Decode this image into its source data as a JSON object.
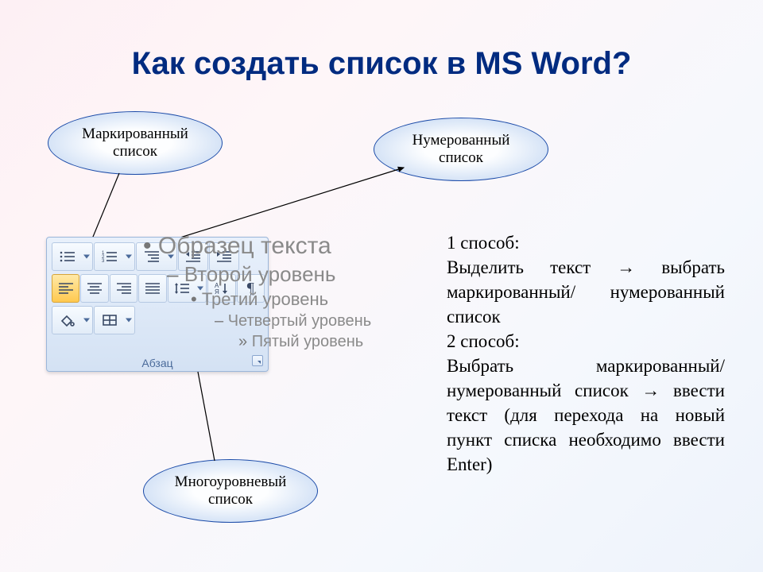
{
  "title": "Как создать список в MS Word?",
  "callouts": {
    "bulleted": "Маркированный\nсписок",
    "numbered": "Нумерованный\nсписок",
    "multilevel": "Многоуровневый\nсписок"
  },
  "ribbon": {
    "group_label": "Абзац",
    "buttons": {
      "bullets": "bullets",
      "numbering": "numbering",
      "multilevel": "multilevel",
      "decrease_indent": "decrease-indent",
      "increase_indent": "increase-indent",
      "sort": "sort",
      "show_marks": "¶",
      "align_left": "align-left",
      "align_center": "align-center",
      "align_right": "align-right",
      "justify": "justify",
      "line_spacing": "line-spacing",
      "shading": "shading",
      "borders": "borders"
    }
  },
  "outline": {
    "lv1": "Образец текста",
    "lv2": "Второй уровень",
    "lv3": "Третий уровень",
    "lv4": "Четвертый уровень",
    "lv5": "Пятый уровень",
    "bullets": {
      "b1": "•",
      "b2": "–",
      "b3": "•",
      "b4": "–",
      "b5": "»"
    }
  },
  "info": {
    "h1": "1 способ:",
    "p1": "Выделить текст → выбрать маркированный/ нумерованный список",
    "h2": "2 способ:",
    "p2": "Выбрать маркированный/нумерованный список → ввести текст (для перехода на новый пункт списка необходимо ввести Enter)"
  }
}
